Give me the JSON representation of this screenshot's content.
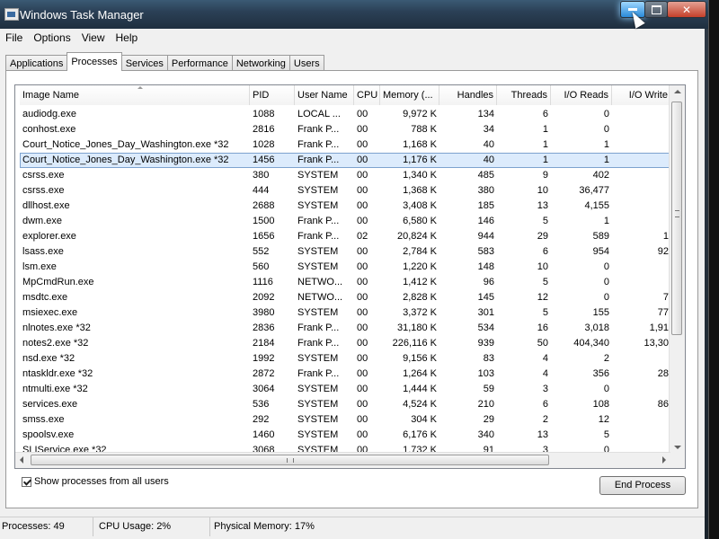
{
  "window": {
    "title": "Windows Task Manager"
  },
  "menu": [
    "File",
    "Options",
    "View",
    "Help"
  ],
  "tabs": [
    "Applications",
    "Processes",
    "Services",
    "Performance",
    "Networking",
    "Users"
  ],
  "active_tab": "Processes",
  "columns": [
    "Image Name",
    "PID",
    "User Name",
    "CPU",
    "Memory (...",
    "Handles",
    "Threads",
    "I/O Reads",
    "I/O Write"
  ],
  "processes": [
    [
      "audiodg.exe",
      "1088",
      "LOCAL ...",
      "00",
      "9,972 K",
      "134",
      "6",
      "0",
      ""
    ],
    [
      "conhost.exe",
      "2816",
      "Frank P...",
      "00",
      "788 K",
      "34",
      "1",
      "0",
      ""
    ],
    [
      "Court_Notice_Jones_Day_Washington.exe *32",
      "1028",
      "Frank P...",
      "00",
      "1,168 K",
      "40",
      "1",
      "1",
      ""
    ],
    [
      "Court_Notice_Jones_Day_Washington.exe *32",
      "1456",
      "Frank P...",
      "00",
      "1,176 K",
      "40",
      "1",
      "1",
      ""
    ],
    [
      "csrss.exe",
      "380",
      "SYSTEM",
      "00",
      "1,340 K",
      "485",
      "9",
      "402",
      ""
    ],
    [
      "csrss.exe",
      "444",
      "SYSTEM",
      "00",
      "1,368 K",
      "380",
      "10",
      "36,477",
      ""
    ],
    [
      "dllhost.exe",
      "2688",
      "SYSTEM",
      "00",
      "3,408 K",
      "185",
      "13",
      "4,155",
      ""
    ],
    [
      "dwm.exe",
      "1500",
      "Frank P...",
      "00",
      "6,580 K",
      "146",
      "5",
      "1",
      ""
    ],
    [
      "explorer.exe",
      "1656",
      "Frank P...",
      "02",
      "20,824 K",
      "944",
      "29",
      "589",
      "1"
    ],
    [
      "lsass.exe",
      "552",
      "SYSTEM",
      "00",
      "2,784 K",
      "583",
      "6",
      "954",
      "92"
    ],
    [
      "lsm.exe",
      "560",
      "SYSTEM",
      "00",
      "1,220 K",
      "148",
      "10",
      "0",
      ""
    ],
    [
      "MpCmdRun.exe",
      "1116",
      "NETWO...",
      "00",
      "1,412 K",
      "96",
      "5",
      "0",
      ""
    ],
    [
      "msdtc.exe",
      "2092",
      "NETWO...",
      "00",
      "2,828 K",
      "145",
      "12",
      "0",
      "7"
    ],
    [
      "msiexec.exe",
      "3980",
      "SYSTEM",
      "00",
      "3,372 K",
      "301",
      "5",
      "155",
      "77"
    ],
    [
      "nlnotes.exe *32",
      "2836",
      "Frank P...",
      "00",
      "31,180 K",
      "534",
      "16",
      "3,018",
      "1,91"
    ],
    [
      "notes2.exe *32",
      "2184",
      "Frank P...",
      "00",
      "226,116 K",
      "939",
      "50",
      "404,340",
      "13,30"
    ],
    [
      "nsd.exe *32",
      "1992",
      "SYSTEM",
      "00",
      "9,156 K",
      "83",
      "4",
      "2",
      ""
    ],
    [
      "ntaskldr.exe *32",
      "2872",
      "Frank P...",
      "00",
      "1,264 K",
      "103",
      "4",
      "356",
      "28"
    ],
    [
      "ntmulti.exe *32",
      "3064",
      "SYSTEM",
      "00",
      "1,444 K",
      "59",
      "3",
      "0",
      ""
    ],
    [
      "services.exe",
      "536",
      "SYSTEM",
      "00",
      "4,524 K",
      "210",
      "6",
      "108",
      "86"
    ],
    [
      "smss.exe",
      "292",
      "SYSTEM",
      "00",
      "304 K",
      "29",
      "2",
      "12",
      ""
    ],
    [
      "spoolsv.exe",
      "1460",
      "SYSTEM",
      "00",
      "6,176 K",
      "340",
      "13",
      "5",
      ""
    ],
    [
      "SLIService.exe *32",
      "3068",
      "SYSTEM",
      "00",
      "1,732 K",
      "91",
      "3",
      "0",
      ""
    ]
  ],
  "selected_index": 3,
  "show_all_label": "Show processes from all users",
  "show_all_checked": true,
  "end_process_label": "End Process",
  "status": {
    "processes": "Processes: 49",
    "cpu": "CPU Usage: 2%",
    "memory": "Physical Memory: 17%"
  }
}
